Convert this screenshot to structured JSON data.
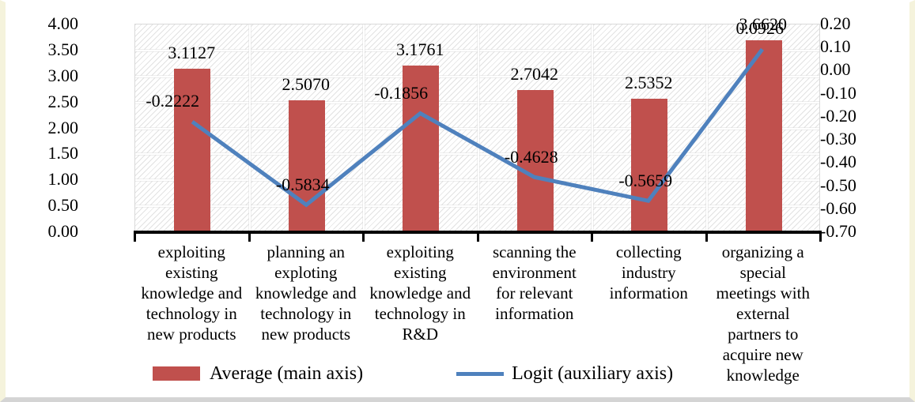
{
  "chart_data": {
    "type": "bar",
    "title": "",
    "subtitle": "",
    "xlabel": "",
    "ylabel": "",
    "grid": true,
    "legend_position": "bottom",
    "categories": [
      "exploiting existing knowledge and technology in new products",
      "planning an exploting knowledge and technology in new products",
      "exploiting existing knowledge and technology in R&D",
      "scanning the environment for relevant information",
      "collecting industry information",
      "organizing a special meetings with external partners to acquire new knowledge"
    ],
    "category_lines": [
      [
        "exploiting",
        "existing",
        "knowledge and",
        "technology in",
        "new products"
      ],
      [
        "planning an",
        "exploting",
        "knowledge and",
        "technology in",
        "new products"
      ],
      [
        "exploiting",
        "existing",
        "knowledge and",
        "technology in",
        "R&D"
      ],
      [
        "scanning the",
        "environment",
        "for relevant",
        "information"
      ],
      [
        "collecting",
        "industry",
        "information"
      ],
      [
        "organizing a",
        "special",
        "meetings with",
        "external",
        "partners to",
        "acquire new",
        "knowledge"
      ]
    ],
    "series": [
      {
        "name": "Average (main axis)",
        "type": "bar",
        "axis": "main",
        "color": "#c0504d",
        "values": [
          3.1127,
          2.507,
          3.1761,
          2.7042,
          2.5352,
          3.662
        ],
        "labels": [
          "3.1127",
          "2.5070",
          "3.1761",
          "2.7042",
          "2.5352",
          "3.6620"
        ]
      },
      {
        "name": "Logit (auxiliary axis)",
        "type": "line",
        "axis": "auxiliary",
        "color": "#4f81bd",
        "values": [
          -0.2222,
          -0.5834,
          -0.1856,
          -0.4628,
          -0.5659,
          0.0926
        ],
        "labels": [
          "-0.2222",
          "-0.5834",
          "-0.1856",
          "-0.4628",
          "-0.5659",
          "0.0926"
        ]
      }
    ],
    "primary_axis": {
      "ylim": [
        0.0,
        4.0
      ],
      "step": 0.5,
      "ticks": [
        "4.00",
        "3.50",
        "3.00",
        "2.50",
        "2.00",
        "1.50",
        "1.00",
        "0.50",
        "0.00"
      ]
    },
    "secondary_axis": {
      "ylim": [
        -0.7,
        0.2
      ],
      "step": 0.1,
      "ticks": [
        "0.20",
        "0.10",
        "0.00",
        "-0.10",
        "-0.20",
        "-0.30",
        "-0.40",
        "-0.50",
        "-0.60",
        "-0.70"
      ]
    },
    "legend": [
      {
        "label": "Average (main axis)",
        "marker": "bar-swatch",
        "color": "#c0504d"
      },
      {
        "label": "Logit (auxiliary axis)",
        "marker": "line-swatch",
        "color": "#4f81bd"
      }
    ]
  }
}
